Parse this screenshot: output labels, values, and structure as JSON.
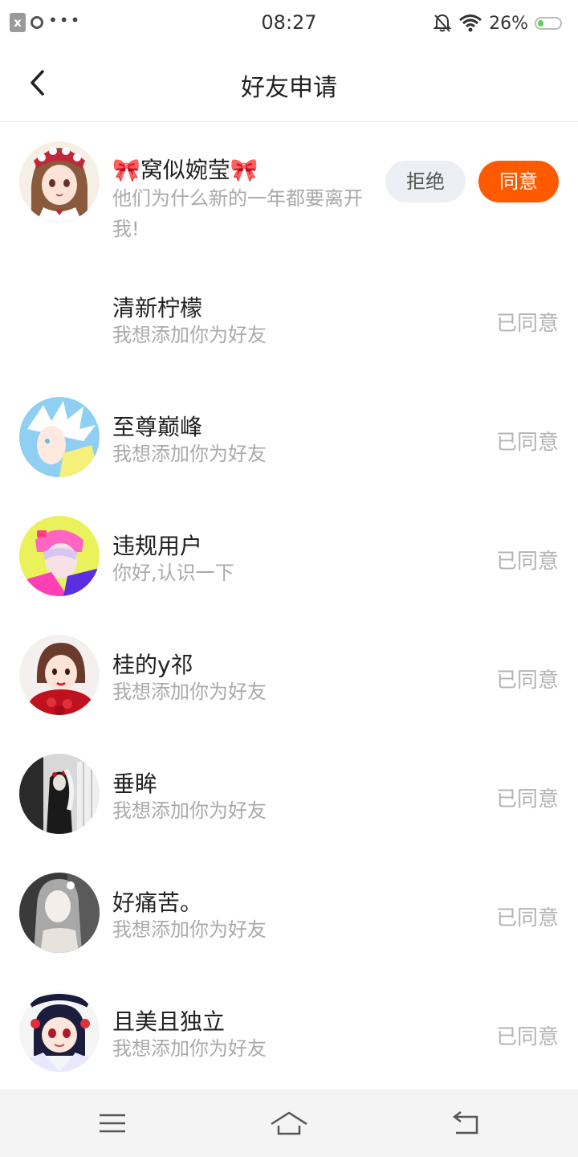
{
  "status_bar": {
    "time": "08:27",
    "battery_text": "26%",
    "notif_icon": "x",
    "more": "•••",
    "battery_level": 0.26,
    "icons": [
      "notification-x-icon",
      "location-dot-icon",
      "more-dots-icon",
      "mute-bell-icon",
      "wifi-icon",
      "battery-icon"
    ]
  },
  "header": {
    "title": "好友申请",
    "back_icon": "chevron-left-icon"
  },
  "requests": [
    {
      "name": "窝似婉莹",
      "message": "他们为什么新的一年都要离开我!",
      "reject_label": "拒绝",
      "accept_label": "同意",
      "pending": true
    },
    {
      "name": "清新柠檬",
      "message": "我想添加你为好友",
      "status": "已同意"
    },
    {
      "name": "至尊巅峰",
      "message": "我想添加你为好友",
      "status": "已同意"
    },
    {
      "name": "违规用户",
      "message": "你好,认识一下",
      "status": "已同意"
    },
    {
      "name": "桂的y祁",
      "message": "我想添加你为好友",
      "status": "已同意"
    },
    {
      "name": "垂眸",
      "message": "我想添加你为好友",
      "status": "已同意"
    },
    {
      "name": "好痛苦。",
      "message": "我想添加你为好友",
      "status": "已同意"
    },
    {
      "name": "且美且独立",
      "message": "我想添加你为好友",
      "status": "已同意"
    }
  ],
  "bow_emoji": "🎀",
  "bottom_nav": {
    "icons": [
      "menu-icon",
      "home-icon",
      "return-icon"
    ]
  },
  "colors": {
    "accent": "#ff5a00",
    "reject_bg": "#eceff4",
    "muted_text": "#aaaaaa"
  }
}
